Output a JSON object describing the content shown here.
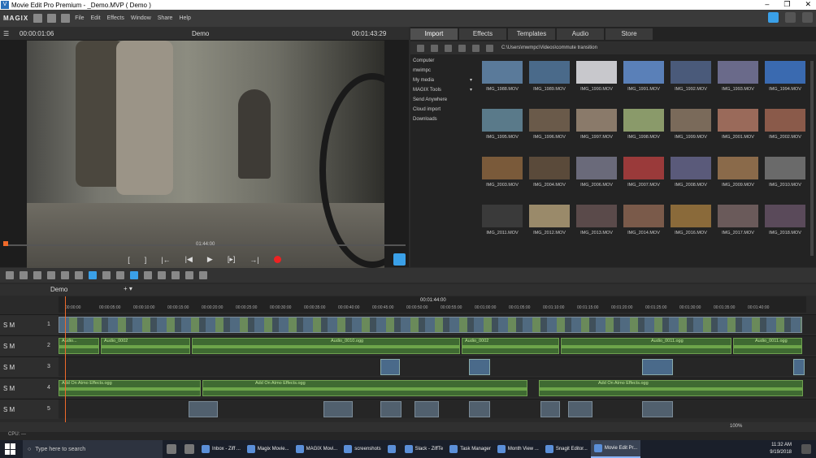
{
  "window": {
    "title": "Movie Edit Pro Premium - _Demo.MVP ( Demo )",
    "logo": "V"
  },
  "menu": {
    "brand": "MAGIX",
    "items": [
      "File",
      "Edit",
      "Effects",
      "Window",
      "Share",
      "Help"
    ]
  },
  "preview": {
    "timecode": "00:00:01:06",
    "title": "Demo",
    "duration": "00:01:43:29",
    "scrub_time": "01:44:00",
    "transport": [
      "[",
      "]",
      "|←",
      "|◀",
      "▶",
      "[▸]",
      "→|"
    ]
  },
  "media": {
    "tabs": [
      "Import",
      "Effects",
      "Templates",
      "Audio",
      "Store"
    ],
    "active_tab": "Import",
    "path": "C:\\Users\\mwmpc\\Videos\\commute transition",
    "tree": [
      "Computer",
      "mwimpc",
      "My media",
      "MAGIX Tools",
      "Send Anywhere",
      "Cloud import",
      "Downloads"
    ],
    "files": [
      "IMG_1988.MOV",
      "IMG_1989.MOV",
      "IMG_1990.MOV",
      "IMG_1991.MOV",
      "IMG_1992.MOV",
      "IMG_1993.MOV",
      "IMG_1994.MOV",
      "IMG_1995.MOV",
      "IMG_1996.MOV",
      "IMG_1997.MOV",
      "IMG_1998.MOV",
      "IMG_1999.MOV",
      "IMG_2001.MOV",
      "IMG_2002.MOV",
      "IMG_2003.MOV",
      "IMG_2004.MOV",
      "IMG_2006.MOV",
      "IMG_2007.MOV",
      "IMG_2008.MOV",
      "IMG_2009.MOV",
      "IMG_2010.MOV",
      "IMG_2011.MOV",
      "IMG_2012.MOV",
      "IMG_2013.MOV",
      "IMG_2014.MOV",
      "IMG_2016.MOV",
      "IMG_2017.MOV",
      "IMG_2018.MOV"
    ],
    "thumb_colors": [
      "#5a7a9a",
      "#4a6a8a",
      "#c8c8cc",
      "#5a80b8",
      "#4a5a7a",
      "#6a6a8a",
      "#3a6ab0",
      "#5a7a8a",
      "#6a5a4a",
      "#8a7a6a",
      "#8a9a6a",
      "#7a6a5a",
      "#9a6a5a",
      "#8a5a4a",
      "#7a5a3a",
      "#5a4a3a",
      "#6a6a7a",
      "#9a3a3a",
      "#5a5a7a",
      "#8a6a4a",
      "#6a6a6a",
      "#3a3a3a",
      "#9a8a6a",
      "#5a4a4a",
      "#7a5a4a",
      "#8a6a3a",
      "#6a5a5a",
      "#5a4a5a"
    ]
  },
  "timeline": {
    "project_tab": "Demo",
    "center_time": "00:01:44:00",
    "ruler": [
      "00:00:00",
      "00:00:05:00",
      "00:00:10:00",
      "00:00:15:00",
      "00:00:20:00",
      "00:00:25:00",
      "00:00:30:00",
      "00:00:35:00",
      "00:00:40:00",
      "00:00:45:00",
      "00:00:50:00",
      "00:00:55:00",
      "00:01:00:00",
      "00:01:05:00",
      "00:01:10:00",
      "00:01:15:00",
      "00:01:20:00",
      "00:01:25:00",
      "00:01:30:00",
      "00:01:35:00",
      "00:01:40:00"
    ],
    "track_labels": [
      "1",
      "2",
      "3",
      "4",
      "5"
    ],
    "track_head": "S M",
    "audio_clips": [
      "Audio...",
      "Audio_0002",
      "Audio_0010.ogg",
      "Audio_0002",
      "Audio_0011.ogg",
      "Audio_0011.ogg"
    ],
    "fx_clips": [
      "Add On Atmo Effects.ogg",
      "Add On Atmo Effects.ogg",
      "Add On Atmo Effects.ogg"
    ],
    "zoom": "100%",
    "cpu": "CPU: ---"
  },
  "taskbar": {
    "search_placeholder": "Type here to search",
    "apps": [
      "Inbox - Ziff ...",
      "Magix Movie...",
      "MAGIX Movi...",
      "screenshots",
      "",
      "Slack - ZiffTe",
      "Task Manager",
      "Month View ...",
      "Snagit Editor...",
      "Movie Edit Pr..."
    ],
    "time": "11:32 AM",
    "date": "9/19/2018"
  }
}
